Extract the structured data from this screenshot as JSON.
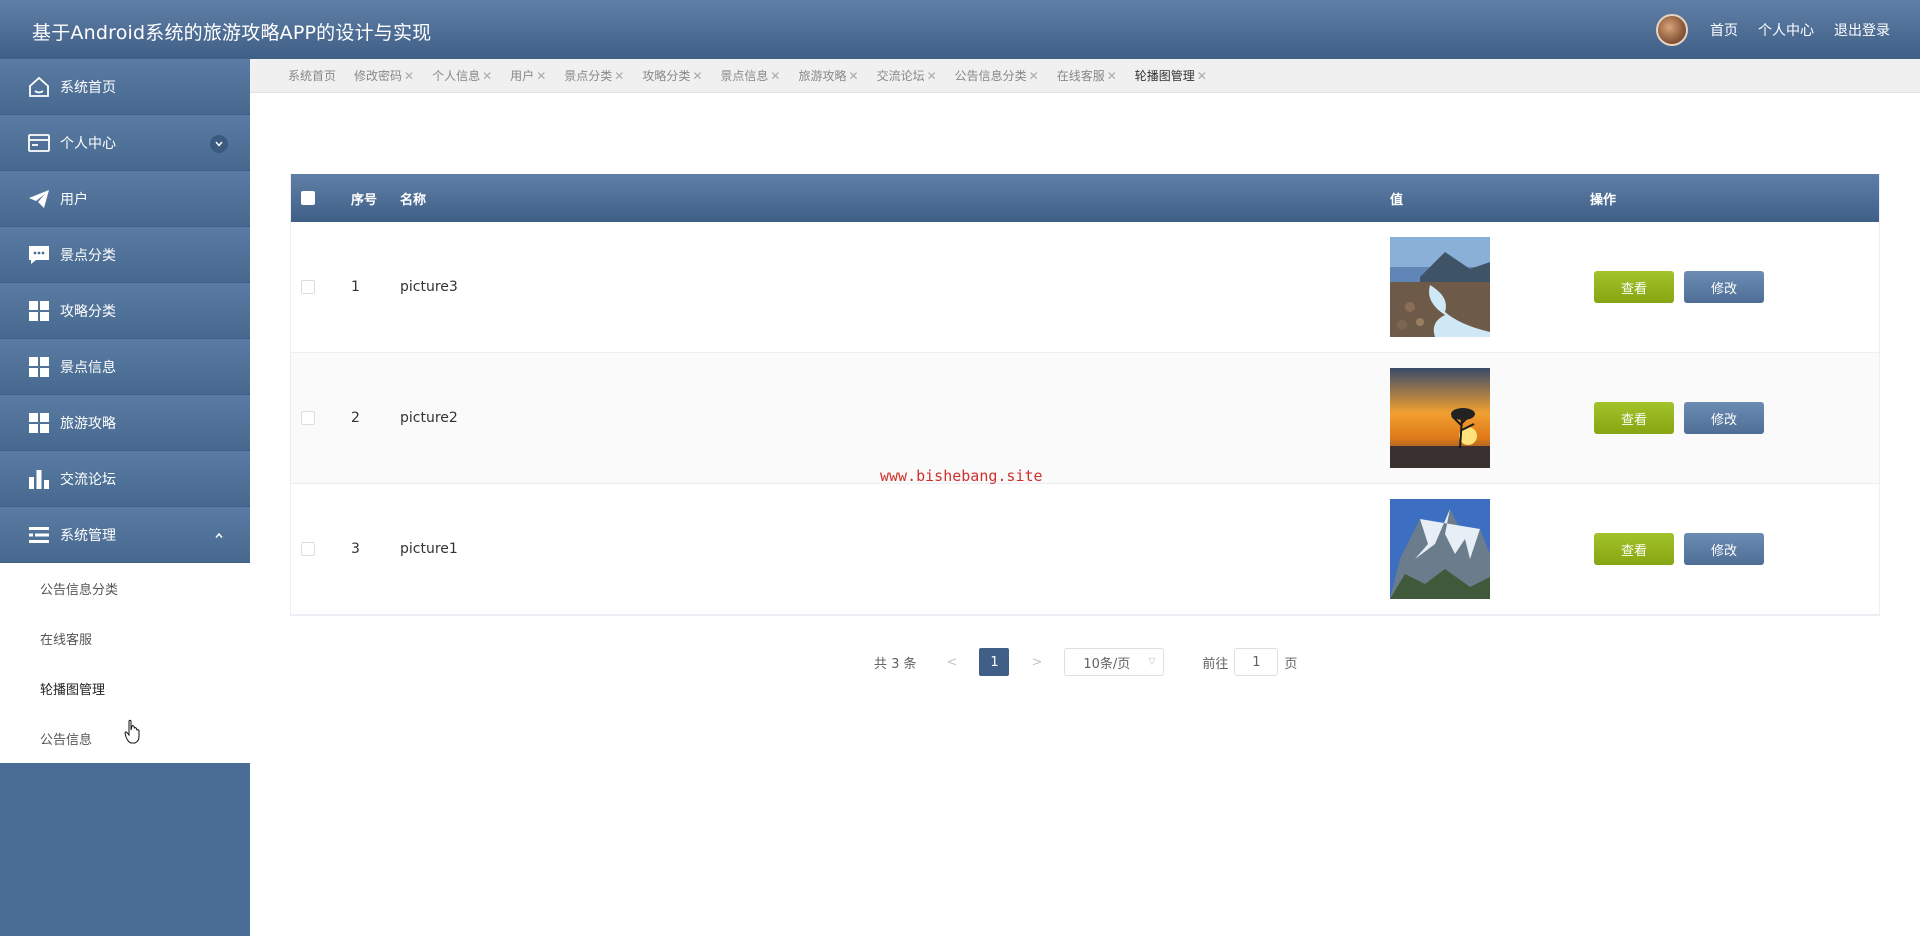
{
  "app": {
    "title": "基于Android系统的旅游攻略APP的设计与实现"
  },
  "header": {
    "links": [
      "首页",
      "个人中心",
      "退出登录"
    ]
  },
  "sidebar": {
    "items": [
      {
        "label": "系统首页",
        "icon": "home-icon"
      },
      {
        "label": "个人中心",
        "icon": "card-icon",
        "expander": "down"
      },
      {
        "label": "用户",
        "icon": "paper-plane-icon"
      },
      {
        "label": "景点分类",
        "icon": "chat-icon"
      },
      {
        "label": "攻略分类",
        "icon": "grid-icon"
      },
      {
        "label": "景点信息",
        "icon": "grid-icon"
      },
      {
        "label": "旅游攻略",
        "icon": "grid-icon"
      },
      {
        "label": "交流论坛",
        "icon": "bar-chart-icon"
      },
      {
        "label": "系统管理",
        "icon": "list-icon",
        "expander": "up"
      }
    ],
    "submenu": [
      "公告信息分类",
      "在线客服",
      "轮播图管理",
      "公告信息"
    ],
    "active_sub": "轮播图管理"
  },
  "tabs": [
    {
      "label": "系统首页",
      "closable": false
    },
    {
      "label": "修改密码",
      "closable": true
    },
    {
      "label": "个人信息",
      "closable": true
    },
    {
      "label": "用户",
      "closable": true
    },
    {
      "label": "景点分类",
      "closable": true
    },
    {
      "label": "攻略分类",
      "closable": true
    },
    {
      "label": "景点信息",
      "closable": true
    },
    {
      "label": "旅游攻略",
      "closable": true
    },
    {
      "label": "交流论坛",
      "closable": true
    },
    {
      "label": "公告信息分类",
      "closable": true
    },
    {
      "label": "在线客服",
      "closable": true
    },
    {
      "label": "轮播图管理",
      "closable": true,
      "active": true
    }
  ],
  "table": {
    "headers": {
      "index": "序号",
      "name": "名称",
      "value": "值",
      "actions": "操作"
    },
    "rows": [
      {
        "index": "1",
        "name": "picture3",
        "image": "river-landscape"
      },
      {
        "index": "2",
        "name": "picture2",
        "image": "sunset-tree"
      },
      {
        "index": "3",
        "name": "picture1",
        "image": "snowy-mountain"
      }
    ],
    "view_label": "查看",
    "edit_label": "修改"
  },
  "watermark": "www.bishebang.site",
  "pagination": {
    "total_text": "共 3 条",
    "prev": "<",
    "current_page": "1",
    "next": ">",
    "page_size": "10条/页",
    "goto_prefix": "前往",
    "goto_value": "1",
    "goto_suffix": "页"
  },
  "colors": {
    "header": "#4e6e95",
    "sidebar": "#4a6d95",
    "view_button": "#94b41c",
    "edit_button": "#5d7da4",
    "page_active": "#3f5f87"
  }
}
